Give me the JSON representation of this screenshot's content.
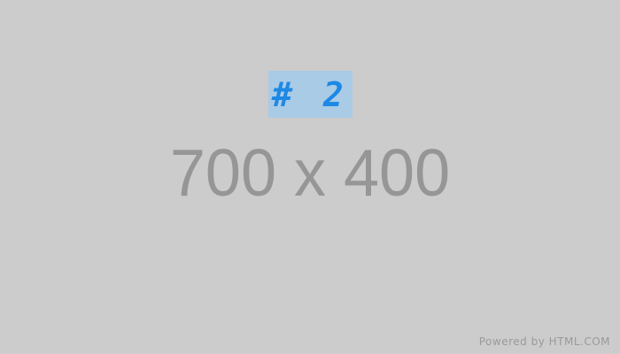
{
  "placeholder": {
    "tag": "# 2",
    "dimensions": "700 x 400",
    "footer": "Powered by HTML.COM"
  },
  "colors": {
    "background": "#cccccc",
    "tag_background": "#a9cbe6",
    "tag_text": "#1e88e5",
    "dimension_text": "#969696",
    "footer_text": "#9a9a9a"
  }
}
